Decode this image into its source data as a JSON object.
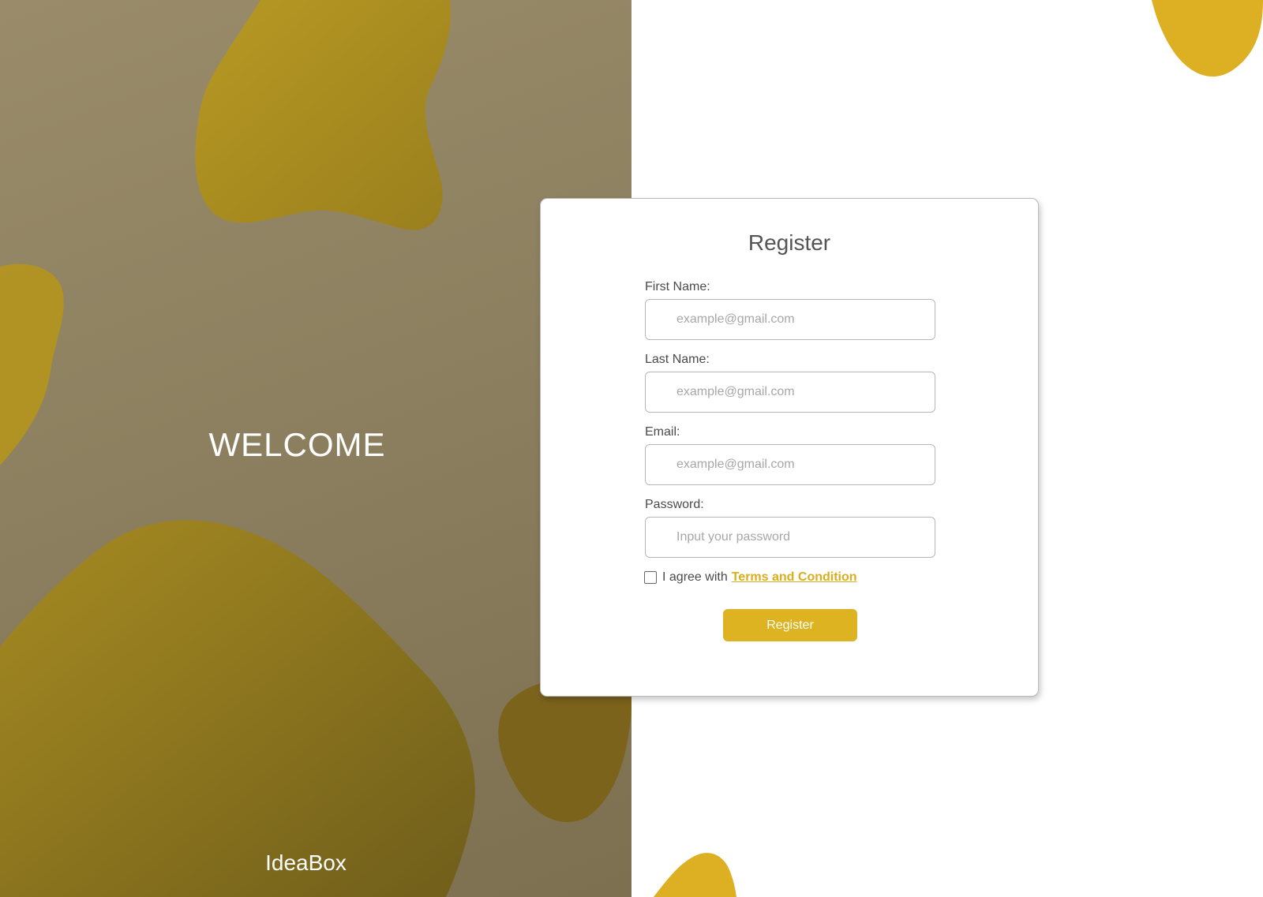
{
  "hero": {
    "welcome_text": "WELCOME",
    "brand_name": "IdeaBox"
  },
  "form": {
    "title": "Register",
    "fields": [
      {
        "label": "First Name:",
        "placeholder": "example@gmail.com",
        "value": ""
      },
      {
        "label": "Last Name:",
        "placeholder": "example@gmail.com",
        "value": ""
      },
      {
        "label": "Email:",
        "placeholder": "example@gmail.com",
        "value": ""
      },
      {
        "label": "Password:",
        "placeholder": "Input your password",
        "value": ""
      }
    ],
    "agree_text": "I agree with",
    "terms_link_text": "Terms and Condition",
    "terms_checked": false,
    "submit_label": "Register"
  },
  "colors": {
    "accent": "#deb321",
    "panel_background": "#8c8060",
    "blob": "#b8951e"
  }
}
